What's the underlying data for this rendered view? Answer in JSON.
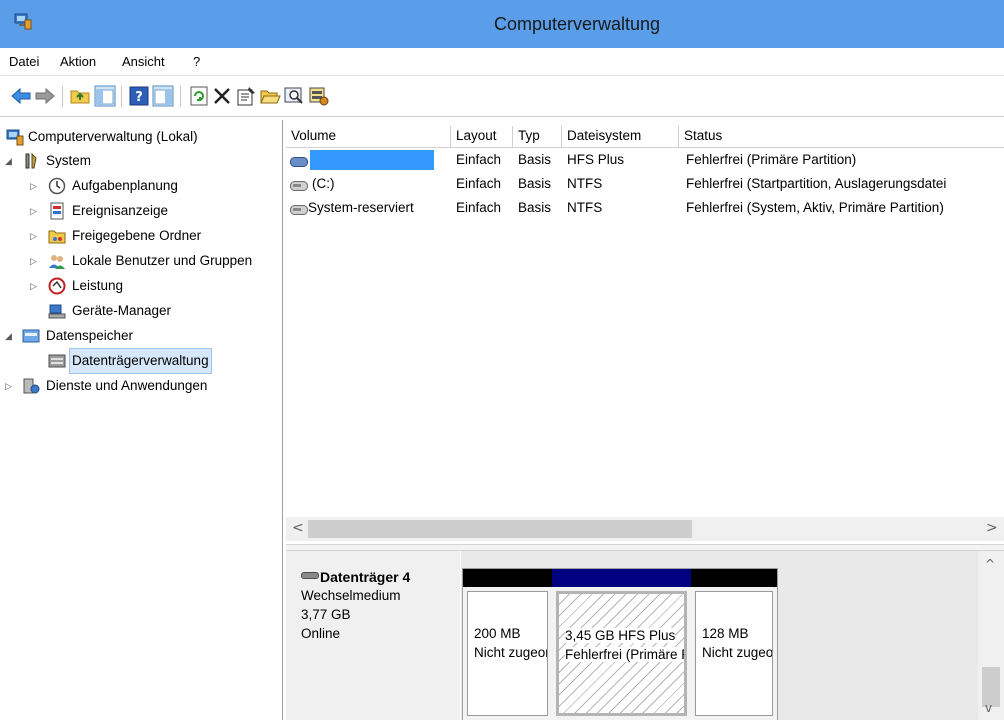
{
  "window": {
    "title": "Computerverwaltung"
  },
  "menu": [
    "Datei",
    "Aktion",
    "Ansicht",
    "?"
  ],
  "toolbar": {
    "icons": [
      "back-arrow-icon",
      "forward-arrow-icon",
      "folder-up-icon",
      "show-hide-tree-icon",
      "help-icon",
      "show-hide-action-pane-icon",
      "refresh-icon",
      "delete-icon",
      "properties-icon",
      "open-folder-icon",
      "search-icon",
      "disk-settings-icon"
    ]
  },
  "tree": {
    "root": "Computerverwaltung (Lokal)",
    "system": "System",
    "aufgabenplanung": "Aufgabenplanung",
    "ereignisanzeige": "Ereignisanzeige",
    "freigegebene": "Freigegebene Ordner",
    "lokale": "Lokale Benutzer und Gruppen",
    "leistung": "Leistung",
    "geraete": "Geräte-Manager",
    "datenspeicher": "Datenspeicher",
    "datentraeger": "Datenträgerverwaltung",
    "dienste": "Dienste und Anwendungen"
  },
  "columns": {
    "volume": "Volume",
    "layout": "Layout",
    "typ": "Typ",
    "dateisystem": "Dateisystem",
    "status": "Status"
  },
  "volumes": [
    {
      "volume": "",
      "layout": "Einfach",
      "typ": "Basis",
      "dateisystem": "HFS Plus",
      "status": "Fehlerfrei (Primäre Partition)"
    },
    {
      "volume": "(C:)",
      "layout": "Einfach",
      "typ": "Basis",
      "dateisystem": "NTFS",
      "status": "Fehlerfrei (Startpartition, Auslagerungsdatei"
    },
    {
      "volume": "System-reserviert",
      "layout": "Einfach",
      "typ": "Basis",
      "dateisystem": "NTFS",
      "status": "Fehlerfrei (System, Aktiv, Primäre Partition)"
    }
  ],
  "disk": {
    "name": "Datenträger 4",
    "type": "Wechselmedium",
    "size": "3,77 GB",
    "state": "Online",
    "partitions": [
      {
        "line1": "200 MB",
        "line2": "Nicht zugeordnet",
        "bar_color": "#000000"
      },
      {
        "line1": "3,45 GB HFS Plus",
        "line2": "Fehlerfrei (Primäre Partition)",
        "bar_color": "#000080"
      },
      {
        "line1": "128 MB",
        "line2": "Nicht zugeordnet",
        "bar_color": "#000000"
      }
    ]
  },
  "colors": {
    "titlebar": "#5a9ee9",
    "selection_highlight": "#3399ff",
    "selected_tree_item": "#d5e7f8"
  }
}
